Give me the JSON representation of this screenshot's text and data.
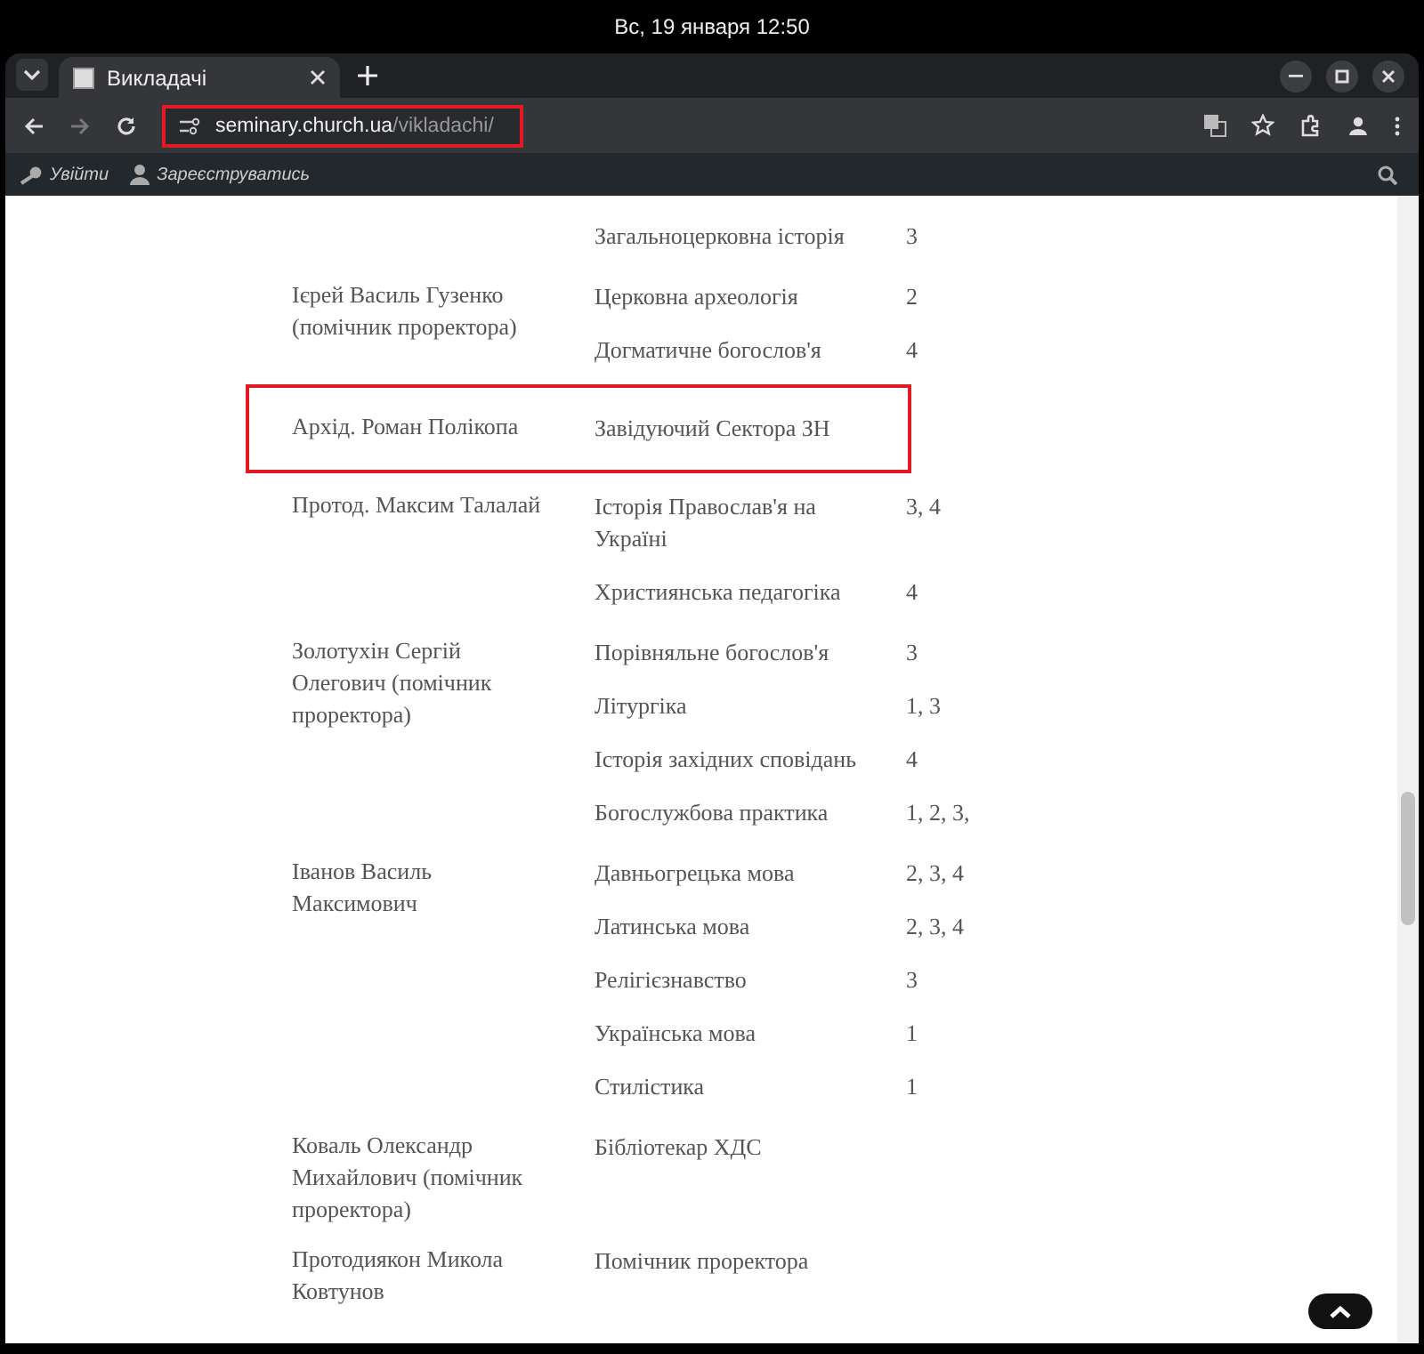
{
  "system_bar": {
    "clock": "Вс, 19 января  12:50"
  },
  "tabs": [
    {
      "title": "Викладачі",
      "selected": true
    }
  ],
  "address_bar": {
    "host": "seminary.church.ua",
    "path": "/vikladachi/",
    "highlighted": true
  },
  "admin_bar": {
    "links": [
      "Увійти",
      "Зареєструватись"
    ]
  },
  "teachers": [
    {
      "highlighted": false,
      "subjects": [
        {
          "name": "Загальноцерковна історія",
          "years": "3"
        }
      ]
    },
    {
      "name": "Ієрей Василь Гузенко (помічник проректора)",
      "highlighted": false,
      "subjects": [
        {
          "name": "Церковна археологія",
          "years": "2"
        },
        {
          "name": "Догматичне богослов'я",
          "years": "4"
        }
      ]
    },
    {
      "name": "Архід. Роман Полікопа",
      "highlighted": true,
      "subjects": [
        {
          "name": "Завідуючий Сектора ЗН"
        }
      ]
    },
    {
      "name": "Протод. Максим Талалай",
      "highlighted": false,
      "subjects": [
        {
          "name": "Історія Православ'я на Україні",
          "years": "3, 4"
        },
        {
          "name": "Християнська педагогіка",
          "years": "4"
        }
      ]
    },
    {
      "name": "Золотухін Сергій Олегович (помічник проректора)",
      "highlighted": false,
      "subjects": [
        {
          "name": "Порівняльне богослов'я",
          "years": "3"
        },
        {
          "name": "Літургіка",
          "years": "1, 3"
        },
        {
          "name": "Історія західних сповідань",
          "years": "4"
        },
        {
          "name": "Богослужбова практика",
          "years": "1, 2, 3,"
        }
      ]
    },
    {
      "name": "Іванов Василь Максимович",
      "highlighted": false,
      "subjects": [
        {
          "name": "Давньогрецька мова",
          "years": "2, 3, 4"
        },
        {
          "name": "Латинська мова",
          "years": "2, 3, 4"
        },
        {
          "name": "Релігієзнавство",
          "years": "3"
        },
        {
          "name": "Українська мова",
          "years": "1"
        },
        {
          "name": "Стилістика",
          "years": "1"
        }
      ]
    },
    {
      "name": "Коваль Олександр Михайлович (помічник проректора)",
      "highlighted": false,
      "subjects": [
        {
          "name": "Бібліотекар ХДС"
        }
      ]
    },
    {
      "name": "Протодиякон Микола Ковтунов",
      "highlighted": false,
      "subjects": [
        {
          "name": "Помічник проректора"
        }
      ]
    }
  ]
}
